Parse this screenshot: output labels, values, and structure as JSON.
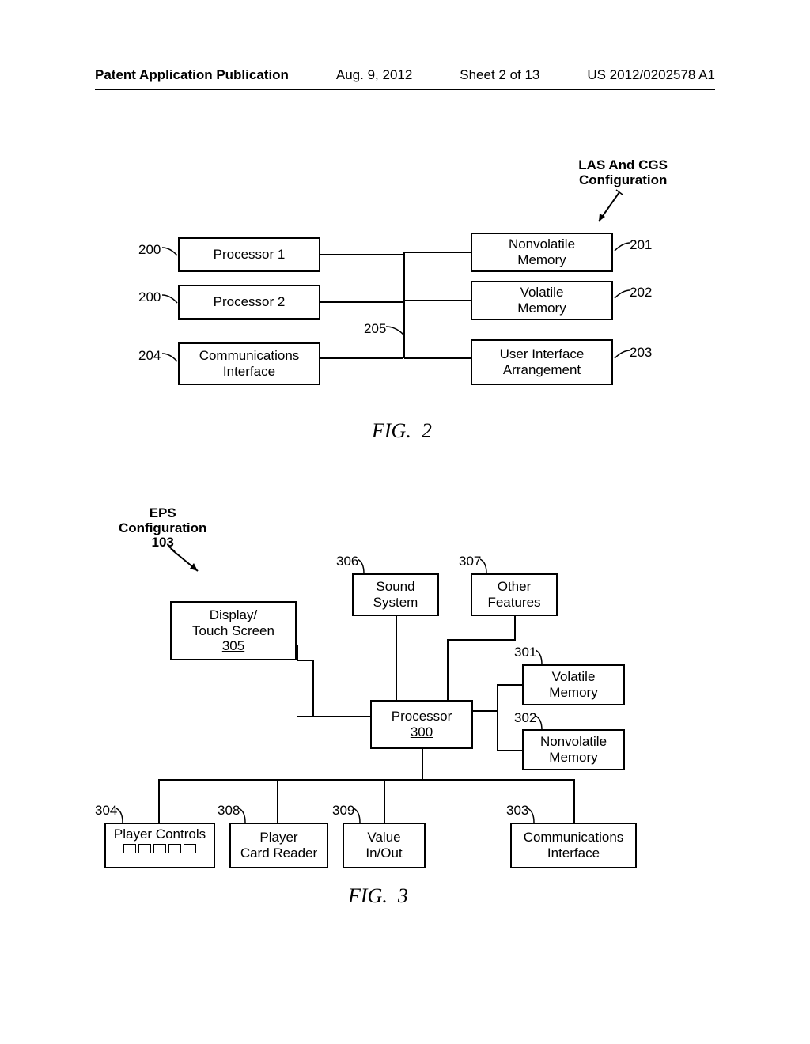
{
  "header": {
    "publication": "Patent Application Publication",
    "date": "Aug. 9, 2012",
    "sheet": "Sheet 2 of 13",
    "pubno": "US 2012/0202578 A1"
  },
  "fig2": {
    "title_l1": "LAS And CGS",
    "title_l2": "Configuration",
    "caption": "FIG.  2",
    "boxes": {
      "proc1": "Processor 1",
      "proc2": "Processor 2",
      "comm": "Communications\nInterface",
      "nvmem": "Nonvolatile\nMemory",
      "vmem": "Volatile\nMemory",
      "ui": "User Interface\nArrangement"
    },
    "refs": {
      "proc1": "200",
      "proc2": "200",
      "comm": "204",
      "nvmem": "201",
      "vmem": "202",
      "ui": "203",
      "bus": "205"
    }
  },
  "fig3": {
    "title_l1": "EPS",
    "title_l2": "Configuration",
    "title_ref": "103",
    "caption": "FIG.  3",
    "boxes": {
      "display_l1": "Display/",
      "display_l2": "Touch Screen",
      "display_u": "305",
      "sound": "Sound\nSystem",
      "other": "Other\nFeatures",
      "processor_l": "Processor",
      "processor_u": "300",
      "vmem": "Volatile\nMemory",
      "nvmem": "Nonvolatile\nMemory",
      "pcontrols": "Player Controls",
      "preader": "Player\nCard Reader",
      "valio": "Value\nIn/Out",
      "comm": "Communications\nInterface"
    },
    "refs": {
      "sound": "306",
      "other": "307",
      "vmem": "301",
      "nvmem": "302",
      "comm": "303",
      "pcontrols": "304",
      "preader": "308",
      "valio": "309"
    }
  }
}
